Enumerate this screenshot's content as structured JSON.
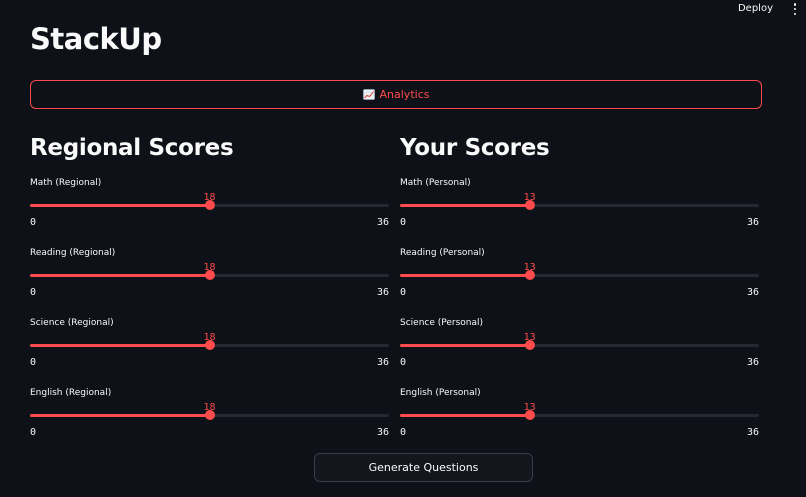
{
  "header": {
    "deploy_label": "Deploy",
    "menu_icon": "kebab-menu-icon"
  },
  "app": {
    "title": "StackUp"
  },
  "analytics_button": {
    "icon": "chart-increasing-icon",
    "label": "Analytics"
  },
  "colors": {
    "accent": "#ff4b4b",
    "background": "#0e1117",
    "track": "#262730",
    "text": "#fafafa"
  },
  "regional": {
    "title": "Regional Scores",
    "sliders": [
      {
        "label": "Math (Regional)",
        "value": 18,
        "min": 0,
        "max": 36
      },
      {
        "label": "Reading (Regional)",
        "value": 18,
        "min": 0,
        "max": 36
      },
      {
        "label": "Science (Regional)",
        "value": 18,
        "min": 0,
        "max": 36
      },
      {
        "label": "English (Regional)",
        "value": 18,
        "min": 0,
        "max": 36
      }
    ]
  },
  "personal": {
    "title": "Your Scores",
    "sliders": [
      {
        "label": "Math (Personal)",
        "value": 13,
        "min": 0,
        "max": 36
      },
      {
        "label": "Reading (Personal)",
        "value": 13,
        "min": 0,
        "max": 36
      },
      {
        "label": "Science (Personal)",
        "value": 13,
        "min": 0,
        "max": 36
      },
      {
        "label": "English (Personal)",
        "value": 13,
        "min": 0,
        "max": 36
      }
    ]
  },
  "generate_button": {
    "label": "Generate Questions"
  }
}
